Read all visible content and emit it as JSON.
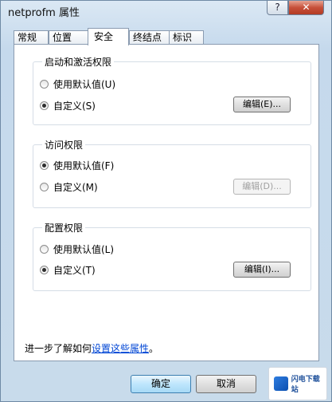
{
  "window": {
    "title": "netprofm 属性",
    "help_label": "?",
    "close_label": "✕"
  },
  "tabs": [
    "常规",
    "位置",
    "安全",
    "终结点",
    "标识"
  ],
  "groups": [
    {
      "label": "启动和激活权限",
      "options": [
        {
          "label": "使用默认值(U)",
          "checked": false
        },
        {
          "label": "自定义(S)",
          "checked": true
        }
      ],
      "edit_label": "编辑(E)...",
      "edit_enabled": true
    },
    {
      "label": "访问权限",
      "options": [
        {
          "label": "使用默认值(F)",
          "checked": true
        },
        {
          "label": "自定义(M)",
          "checked": false
        }
      ],
      "edit_label": "编辑(D)...",
      "edit_enabled": false
    },
    {
      "label": "配置权限",
      "options": [
        {
          "label": "使用默认值(L)",
          "checked": false
        },
        {
          "label": "自定义(T)",
          "checked": true
        }
      ],
      "edit_label": "编辑(I)...",
      "edit_enabled": true
    }
  ],
  "footer": {
    "prefix": "进一步了解如何",
    "link": "设置这些属性",
    "suffix": "。"
  },
  "buttons": {
    "ok": "确定",
    "cancel": "取消"
  },
  "watermark": {
    "text": "闪电下载站"
  }
}
